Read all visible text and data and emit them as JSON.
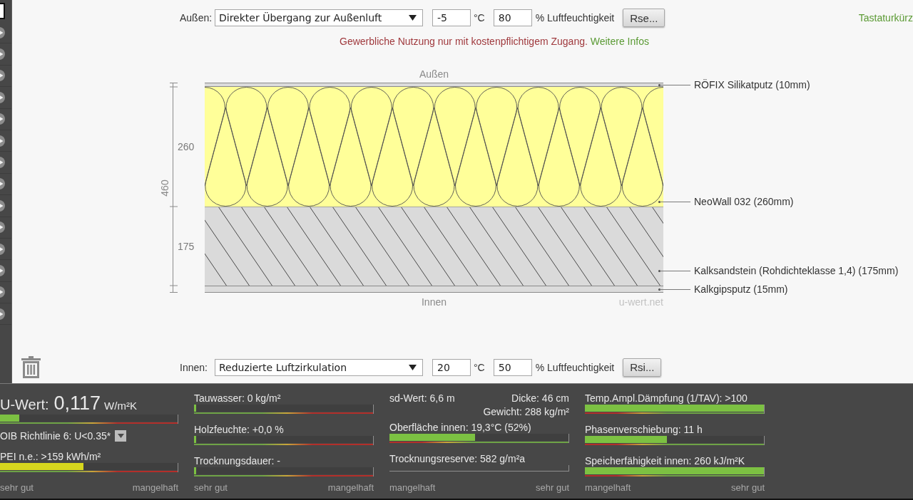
{
  "outside": {
    "label": "Außen:",
    "condition": "Direkter Übergang zur Außenluft",
    "temperature": "-5",
    "temperature_unit": "°C",
    "humidity": "80",
    "humidity_unit": "% Luftfeuchtigkeit",
    "button": "Rse..."
  },
  "shortcuts_link": "Tastaturkürz",
  "notice": {
    "text": "Gewerbliche Nutzung nur mit kostenpflichtigem Zugang.",
    "link": "Weitere Infos"
  },
  "diagram": {
    "top_label": "Außen",
    "total_dimension": "460",
    "layers": [
      {
        "kind": "plaster",
        "name": "RÖFIX Silikatputz (10mm)"
      },
      {
        "kind": "insulation",
        "name": "NeoWall 032 (260mm)",
        "dimension": "260"
      },
      {
        "kind": "masonry",
        "name": "Kalksandstein (Rohdichteklasse 1,4) (175mm)",
        "dimension": "175"
      },
      {
        "kind": "plaster",
        "name": "Kalkgipsputz (15mm)"
      }
    ],
    "bottom_label": "Innen",
    "credit": "u-wert.net"
  },
  "inside": {
    "label": "Innen:",
    "condition": "Reduzierte Luftzirkulation",
    "temperature": "20",
    "temperature_unit": "°C",
    "humidity": "50",
    "humidity_unit": "% Luftfeuchtigkeit",
    "button": "Rsi..."
  },
  "results": [
    {
      "kind": "good_to_bad",
      "entries": [
        {
          "kind": "headline",
          "label": "U-Wert:",
          "value": "0,117",
          "unit": "W/m²K",
          "meter": {
            "kind": "bar",
            "level": 0.11,
            "color": "#7cc142"
          }
        },
        {
          "kind": "selector",
          "label": "OIB Richtlinie 6: U<0.35*"
        },
        {
          "kind": "metric",
          "label": "PEI n.e.: >159 kWh/m²",
          "meter": {
            "kind": "bar",
            "level": 0.47,
            "color": "#d6d61e"
          }
        }
      ],
      "scale": {
        "left": "sehr gut",
        "right": "mangelhaft"
      }
    },
    {
      "kind": "good_to_bad",
      "entries": [
        {
          "kind": "metric",
          "label": "Tauwasser: 0 kg/m²",
          "meter": {
            "kind": "bar",
            "level": 0.01,
            "color": "#7cc142"
          }
        },
        {
          "kind": "metric",
          "label": "Holzfeuchte: +0,0 %",
          "meter": {
            "kind": "bar",
            "level": 0.01,
            "color": "#7cc142"
          }
        },
        {
          "kind": "metric",
          "label": "Trocknungsdauer: -",
          "meter": {
            "kind": "bar",
            "level": 0.01,
            "color": "#7cc142"
          }
        }
      ],
      "scale": {
        "left": "sehr gut",
        "right": "mangelhaft"
      }
    },
    {
      "kind": "bad_to_good",
      "entries": [
        {
          "kind": "facts",
          "left": "sd-Wert: 6,6 m",
          "right": [
            "Dicke: 46 cm",
            "Gewicht: 288 kg/m²"
          ]
        },
        {
          "kind": "metric",
          "label": "Oberfläche innen: 19,3°C (52%)",
          "meter": {
            "kind": "bar",
            "level": 0.48,
            "color": "#7cc142"
          }
        },
        {
          "kind": "metric",
          "label": "Trocknungsreserve: 582 g/m²a",
          "meter": {
            "kind": "line"
          }
        }
      ],
      "scale": {
        "left": "mangelhaft",
        "right": "sehr gut"
      }
    },
    {
      "kind": "bad_to_good",
      "entries": [
        {
          "kind": "metric",
          "label": "Temp.Ampl.Dämpfung (1/TAV): >100",
          "meter": {
            "kind": "bar",
            "level": 1,
            "color": "#7cc142"
          }
        },
        {
          "kind": "metric",
          "label": "Phasenverschiebung: 11 h",
          "meter": {
            "kind": "bar",
            "level": 0.46,
            "color": "#7cc142"
          }
        },
        {
          "kind": "metric",
          "label": "Speicherfähigkeit innen: 260 kJ/m²K",
          "meter": {
            "kind": "bar",
            "level": 1,
            "color": "#7cc142"
          }
        }
      ],
      "scale": {
        "left": "mangelhaft",
        "right": "sehr gut"
      }
    }
  ]
}
